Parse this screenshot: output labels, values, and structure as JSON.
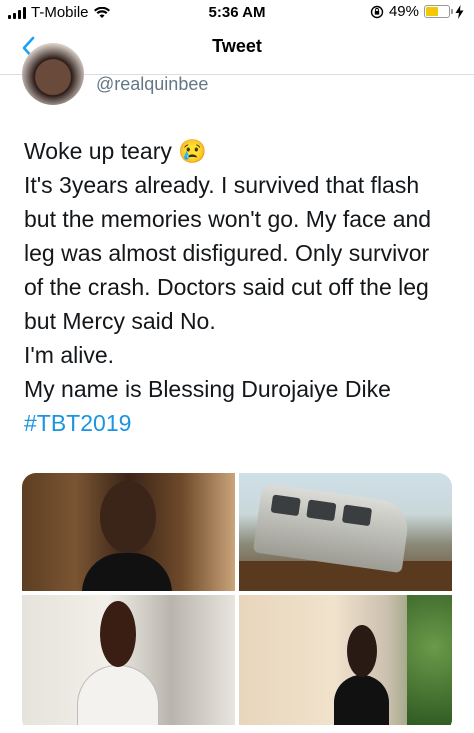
{
  "status_bar": {
    "carrier": "T-Mobile",
    "time": "5:36 AM",
    "battery_percent_label": "49%",
    "battery_level": 0.49,
    "battery_color": "#f4c700"
  },
  "nav": {
    "back_icon": "chevron-left-icon",
    "title": "Tweet",
    "accent": "#1da1f2"
  },
  "tweet": {
    "handle": "@realquinbee",
    "lines": [
      "Woke up teary 😢",
      "It's 3years already. I survived that flash",
      "but the memories won't go. My face and",
      "leg was almost disfigured. Only survivor",
      "of the crash. Doctors said cut off the leg",
      "but  Mercy said No.",
      "I'm alive.",
      "My name is Blessing Durojaiye Dike"
    ],
    "hashtag": "#TBT2019",
    "hashtag_color": "#1b95e0"
  }
}
